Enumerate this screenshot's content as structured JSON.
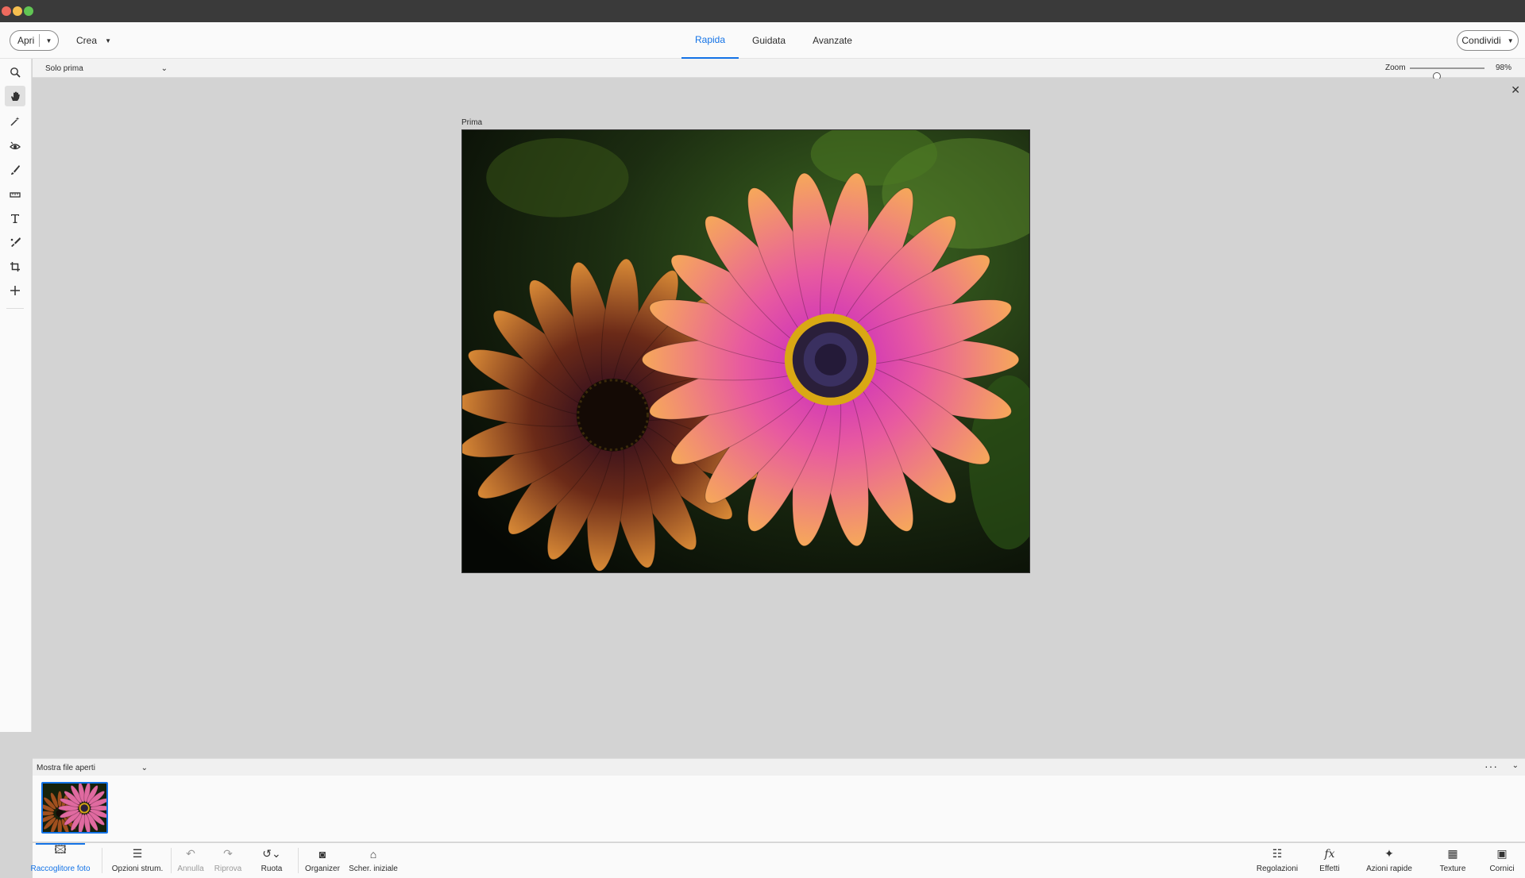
{
  "topbar": {
    "open_label": "Apri",
    "create_label": "Crea",
    "modes": [
      "Rapida",
      "Guidata",
      "Avanzate"
    ],
    "active_mode": "Rapida",
    "share_label": "Condividi"
  },
  "options": {
    "view_select": "Solo prima",
    "zoom_label": "Zoom",
    "zoom_value": "98%",
    "zoom_level": 0.36
  },
  "canvas": {
    "photo_label": "Prima"
  },
  "bin": {
    "select_label": "Mostra file aperti"
  },
  "taskbar": {
    "left": [
      "Raccoglitore foto",
      "Opzioni strum.",
      "Annulla",
      "Riprova",
      "Ruota",
      "Organizer",
      "Scher. iniziale"
    ],
    "right": [
      "Regolazioni",
      "Effetti",
      "Azioni rapide",
      "Texture",
      "Cornici"
    ]
  },
  "colors": {
    "accent": "#1473e6",
    "canvas_bg": "#d3d3d3",
    "titlebar": "#3a3a3a"
  }
}
